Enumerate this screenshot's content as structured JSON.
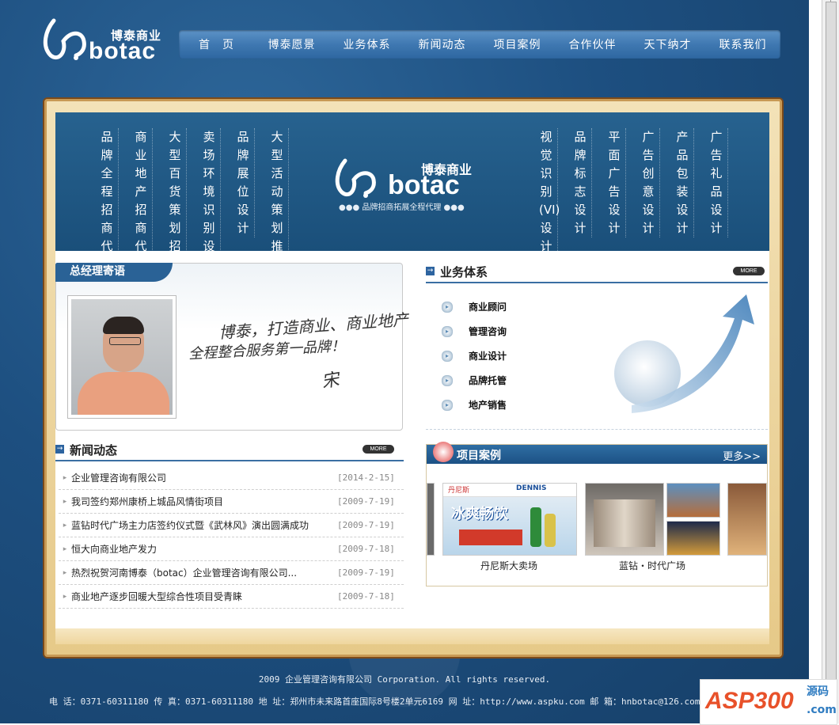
{
  "header": {
    "logo_cn": "博泰商业",
    "logo_en": "botac",
    "nav": [
      "首　页",
      "博泰愿景",
      "业务体系",
      "新闻动态",
      "项目案例",
      "合作伙伴",
      "天下纳才",
      "联系我们"
    ]
  },
  "banner": {
    "left_columns": [
      "品牌全程招商代理",
      "商业地产招商代理",
      "大型百货策划招商",
      "卖场环境识别设计",
      "品牌展位设计",
      "大型活动策划推广"
    ],
    "center_cn": "博泰商业",
    "center_en": "botac",
    "tagline": "●●● 品牌招商拓展全程代理 ●●●",
    "right_columns": [
      "视觉识别(VI)设计",
      "品牌标志设计",
      "平面广告设计",
      "广告创意设计",
      "产品包装设计",
      "广告礼品设计"
    ]
  },
  "gm": {
    "title": "总经理寄语",
    "sig_line1": "博泰，打造商业、商业地产",
    "sig_line2": "全程整合服务第一品牌！",
    "sig_name": "宋"
  },
  "biz": {
    "title": "业务体系",
    "more": "MORE",
    "items": [
      "商业顾问",
      "管理咨询",
      "商业设计",
      "品牌托管",
      "地产销售"
    ]
  },
  "news": {
    "title": "新闻动态",
    "more": "MORE",
    "rows": [
      {
        "title": "企业管理咨询有限公司",
        "date": "[2014-2-15]"
      },
      {
        "title": "我司签约郑州康桥上城品风情街项目",
        "date": "[2009-7-19]"
      },
      {
        "title": "蓝钻时代广场主力店签约仪式暨《武林风》演出圆满成功",
        "date": "[2009-7-19]"
      },
      {
        "title": "恒大向商业地产发力",
        "date": "[2009-7-18]"
      },
      {
        "title": "热烈祝贺河南博泰（botac）企业管理咨询有限公司...",
        "date": "[2009-7-19]"
      },
      {
        "title": "商业地产逐步回暖大型综合性项目受青睐",
        "date": "[2009-7-18]"
      }
    ]
  },
  "cases": {
    "title": "项目案例",
    "more": "更多>>",
    "items": [
      {
        "caption": "丹尼斯大卖场",
        "brand_a": "丹尼斯",
        "brand_b": "DENNIS",
        "promo": "冰爽畅饮"
      },
      {
        "caption": "蓝钻・时代广场"
      }
    ]
  },
  "footer": {
    "copyright": "2009 企业管理咨询有限公司 Corporation. All rights reserved.",
    "contact": "电 话：0371-60311180 传 真：0371-60311180 地 址：郑州市未来路首座国际8号楼2单元6169 网 址：http://www.aspku.com  邮 箱：hnbotac@126.com"
  },
  "watermark": {
    "asp": "ASP300",
    "ym": "源码",
    "com": ".com"
  }
}
